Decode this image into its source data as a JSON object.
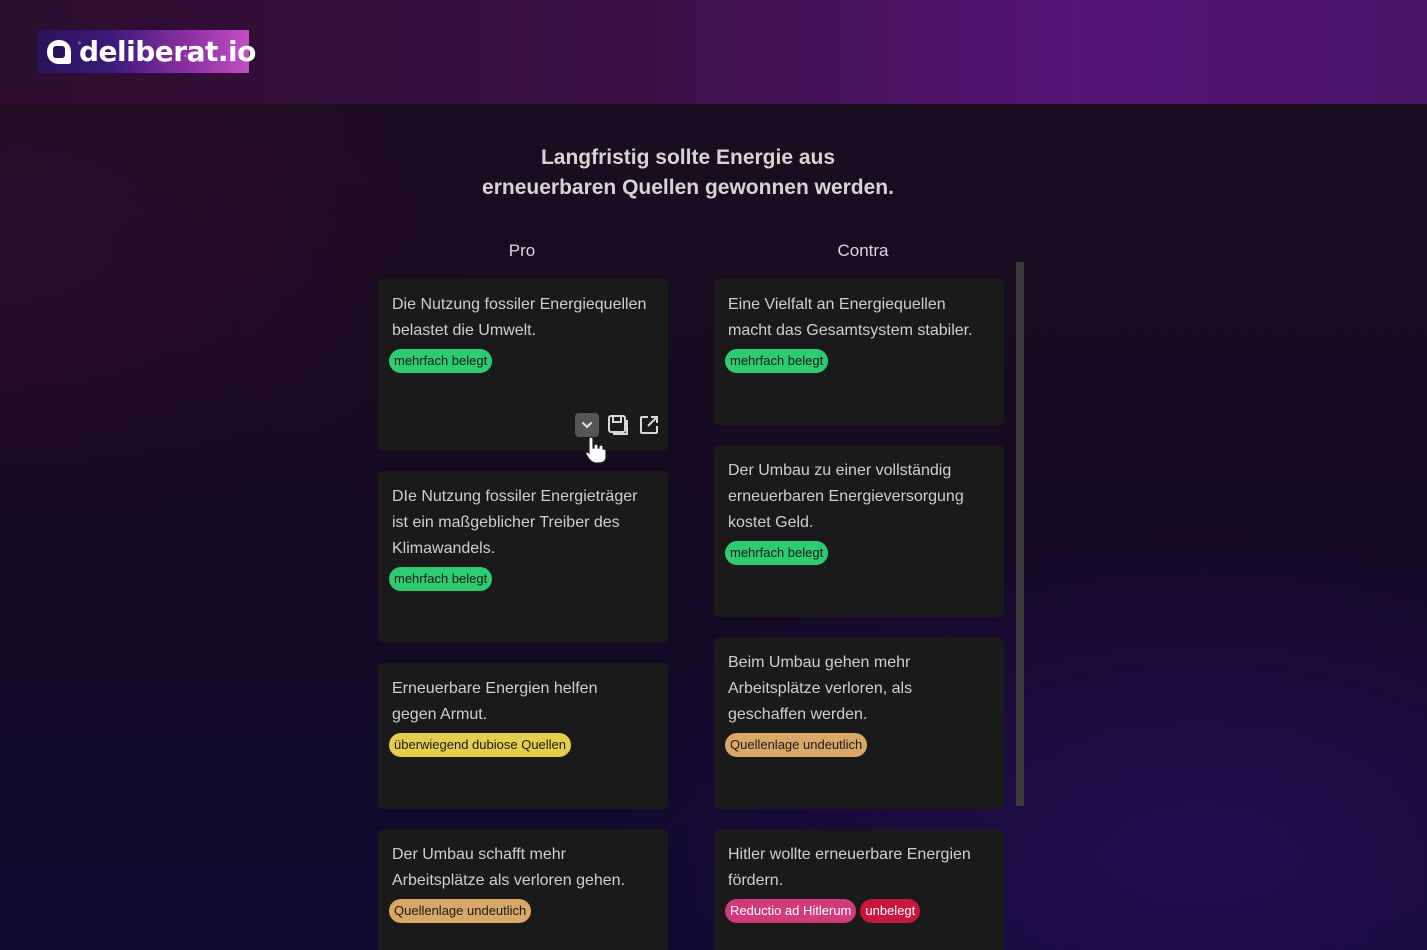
{
  "header": {
    "logo_text": "deliberat.io"
  },
  "topic": {
    "line1": "Langfristig sollte Energie aus",
    "line2": "erneuerbaren Quellen gewonnen werden."
  },
  "columns": {
    "pro_label": "Pro",
    "contra_label": "Contra"
  },
  "pro": [
    {
      "text": "Die Nutzung fossiler Energiequellen belastet die Umwelt.",
      "badges": [
        {
          "label": "mehrfach belegt",
          "color": "#2ecc71"
        }
      ]
    },
    {
      "text": "DIe Nutzung fossiler Energieträger ist ein maßgeblicher Treiber des Klimawandels.",
      "badges": [
        {
          "label": "mehrfach belegt",
          "color": "#2ecc71"
        }
      ]
    },
    {
      "text": "Erneuerbare Energien helfen gegen Armut.",
      "badges": [
        {
          "label": "überwiegend dubiose Quellen",
          "color": "#e3cf4c"
        }
      ]
    },
    {
      "text": "Der Umbau schafft mehr Arbeitsplätze als verloren gehen.",
      "badges": [
        {
          "label": "Quellenlage undeutlich",
          "color": "#d9a866"
        }
      ]
    }
  ],
  "contra": [
    {
      "text": "Eine Vielfalt an Energiequellen macht das Gesamtsystem stabiler.",
      "badges": [
        {
          "label": "mehrfach belegt",
          "color": "#2ecc71"
        }
      ]
    },
    {
      "text": "Der Umbau zu einer vollständig erneuerbaren Energieversorgung kostet Geld.",
      "badges": [
        {
          "label": "mehrfach belegt",
          "color": "#2ecc71"
        }
      ]
    },
    {
      "text": "Beim Umbau gehen mehr Arbeitsplätze verloren, als geschaffen werden.",
      "badges": [
        {
          "label": "Quellenlage undeutlich",
          "color": "#d9a866"
        }
      ]
    },
    {
      "text": "Hitler wollte erneuerbare Energien fördern.",
      "badges": [
        {
          "label": "Reductio ad Hitlerum",
          "color": "#d23a7a"
        },
        {
          "label": "unbelegt",
          "color": "#c8163e"
        }
      ]
    }
  ],
  "card_actions": {
    "icons": [
      "chevron-down-icon",
      "save-icon",
      "external-link-icon"
    ]
  }
}
